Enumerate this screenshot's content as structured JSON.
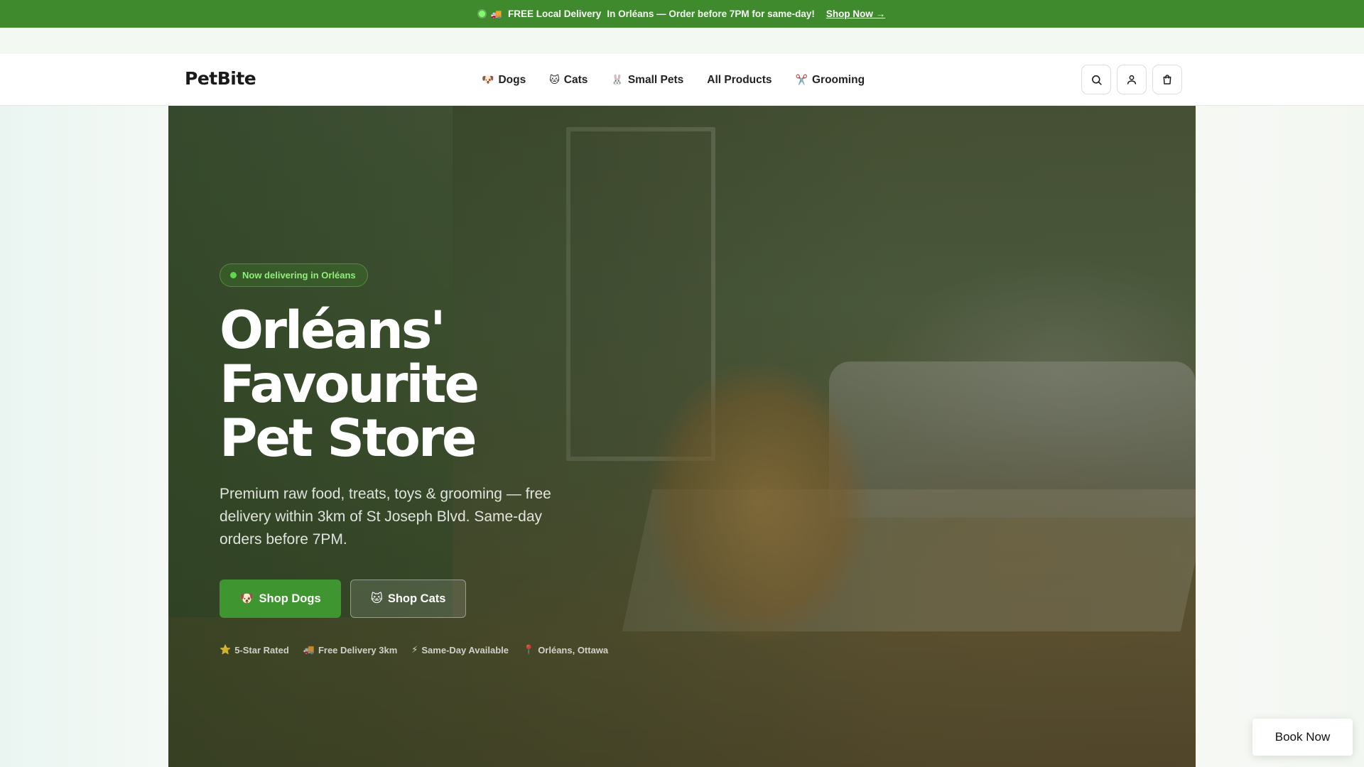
{
  "announcement": {
    "icon": "truck-icon",
    "highlight": "FREE Local Delivery",
    "text": "In Orléans — Order before 7PM for same-day!",
    "cta": "Shop Now →"
  },
  "header": {
    "logo": "PetBite",
    "nav": [
      {
        "label": "Dogs",
        "icon": "🐶"
      },
      {
        "label": "Cats",
        "icon": "🐱"
      },
      {
        "label": "Small Pets",
        "icon": "🐰"
      },
      {
        "label": "All Products",
        "icon": ""
      },
      {
        "label": "Grooming",
        "icon": "✂️"
      }
    ],
    "icons": [
      "search-icon",
      "user-icon",
      "cart-icon"
    ]
  },
  "hero": {
    "badge": "Now delivering in Orléans",
    "headline_line1": "Orléans' Favourite",
    "headline_line2": "Pet Store",
    "subtext": "Premium raw food, treats, toys & grooming — free delivery within 3km of St Joseph Blvd. Same-day orders before 7PM.",
    "primary_cta": {
      "icon": "🐶",
      "label": "Shop Dogs"
    },
    "secondary_cta": {
      "icon": "🐱",
      "label": "Shop Cats"
    },
    "trust": [
      {
        "icon": "⭐",
        "label": "5-Star Rated"
      },
      {
        "icon": "🚚",
        "label": "Free Delivery 3km"
      },
      {
        "icon": "⚡",
        "label": "Same-Day Available"
      },
      {
        "icon": "📍",
        "label": "Orléans, Ottawa"
      }
    ]
  },
  "floating": {
    "book_now": "Book Now"
  },
  "colors": {
    "brand_green": "#3f952f",
    "announce_bg": "#3f8a2c",
    "badge_text": "#8ff07a"
  }
}
